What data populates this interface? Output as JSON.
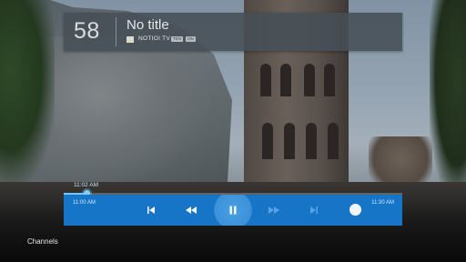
{
  "banner": {
    "channel_number": "58",
    "program_title": "No title",
    "channel_name": "NOTIOI TV",
    "badges": [
      "TEN",
      "ON"
    ]
  },
  "playback": {
    "current_time": "11:02 AM",
    "start_time": "11:00 AM",
    "end_time": "11:30 AM",
    "progress": 0.068,
    "state": "paused"
  },
  "controls": [
    {
      "name": "skip-previous-icon",
      "enabled": true
    },
    {
      "name": "rewind-icon",
      "enabled": true
    },
    {
      "name": "pause-icon",
      "enabled": true,
      "focused": true
    },
    {
      "name": "fast-forward-icon",
      "enabled": false
    },
    {
      "name": "skip-next-icon",
      "enabled": false
    },
    {
      "name": "record-icon",
      "enabled": true
    }
  ],
  "rows": {
    "channels_label": "Channels"
  },
  "colors": {
    "control_bar": "#1675c6",
    "progress": "#74c7ff",
    "banner": "#464e56"
  }
}
